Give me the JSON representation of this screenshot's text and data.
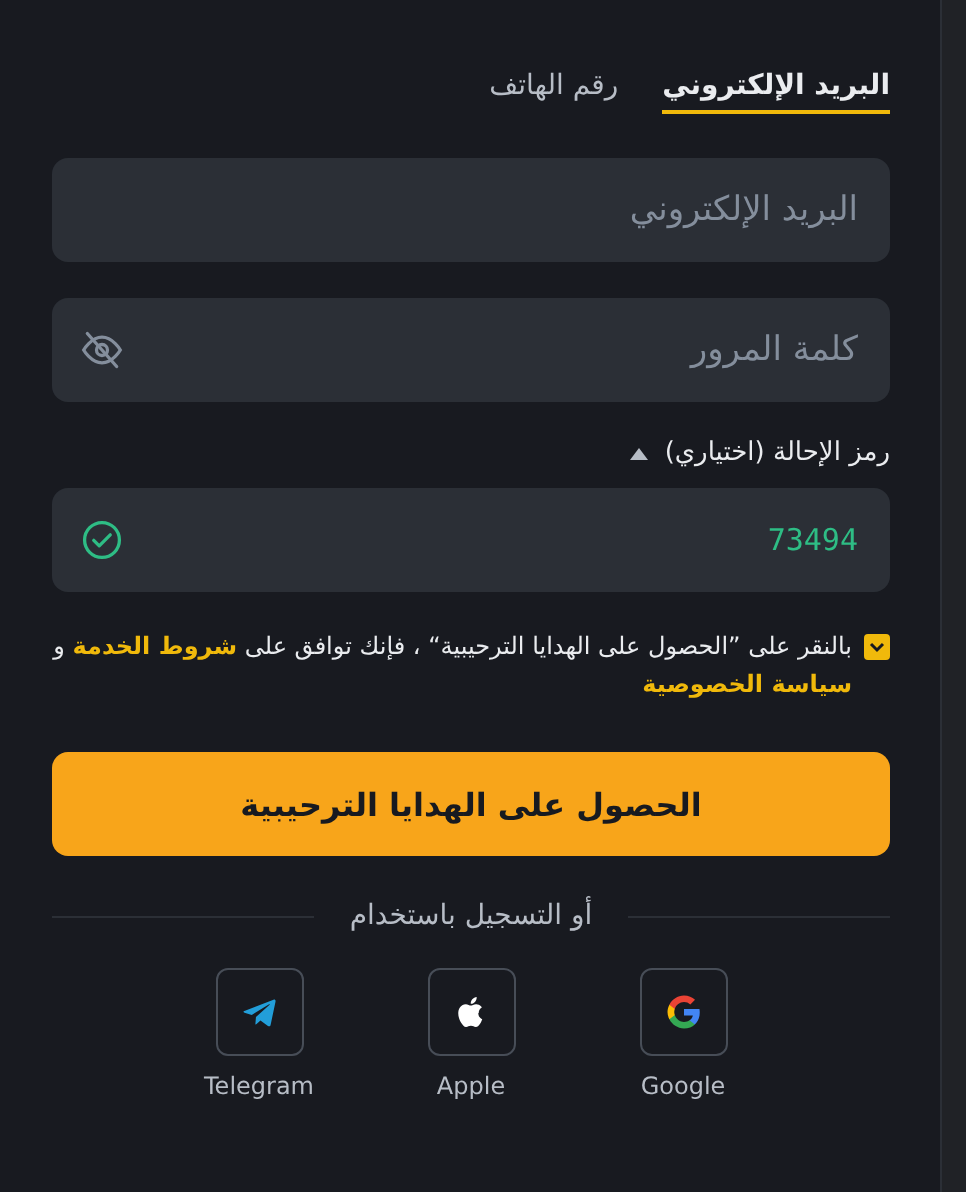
{
  "tabs": [
    {
      "label": "البريد الإلكتروني",
      "selected": true
    },
    {
      "label": "رقم الهاتف",
      "selected": false
    }
  ],
  "email_field": {
    "placeholder": "البريد الإلكتروني"
  },
  "password_field": {
    "placeholder": "كلمة المرور",
    "password_visible": false
  },
  "referral": {
    "label": "رمز الإحالة (اختياري)",
    "expanded": true,
    "value": "73494",
    "valid": true
  },
  "agreement": {
    "checked": true,
    "text": "بالنقر على ”الحصول على الهدايا الترحيبية“ ، فإنك توافق على",
    "terms_link": "شروط الخدمة",
    "connector": "و",
    "privacy_link": "سياسة الخصوصية"
  },
  "submit_button": "الحصول على الهدايا الترحيبية",
  "divider_text": "أو التسجيل باستخدام",
  "social": [
    {
      "kind": "google",
      "label": "Google"
    },
    {
      "kind": "apple",
      "label": "Apple"
    },
    {
      "kind": "telegram",
      "label": "Telegram"
    }
  ]
}
